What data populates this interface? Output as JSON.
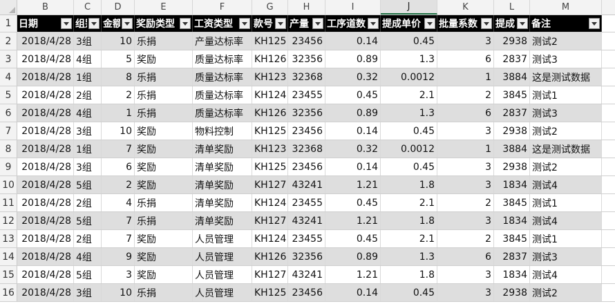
{
  "columns": [
    "B",
    "C",
    "D",
    "E",
    "F",
    "G",
    "H",
    "I",
    "J",
    "K",
    "L",
    "M"
  ],
  "selected_column": "J",
  "header_row_number": "1",
  "headers": [
    "日期",
    "组别",
    "金额",
    "奖励类型",
    "工资类型",
    "款号",
    "产量",
    "工序道数",
    "提成单价",
    "批量系数",
    "提成",
    "备注"
  ],
  "rows": [
    {
      "num": "2",
      "cells": [
        "2018/4/28",
        "3组",
        "10",
        "乐捐",
        "产量达标率",
        "KH125",
        "23456",
        "0.14",
        "0.45",
        "3",
        "2938",
        "测试2"
      ]
    },
    {
      "num": "3",
      "cells": [
        "2018/4/28",
        "4组",
        "5",
        "奖励",
        "质量达标率",
        "KH126",
        "32356",
        "0.89",
        "1.3",
        "6",
        "2837",
        "测试3"
      ]
    },
    {
      "num": "4",
      "cells": [
        "2018/4/28",
        "1组",
        "8",
        "乐捐",
        "质量达标率",
        "KH123",
        "32368",
        "0.32",
        "0.0012",
        "1",
        "3884",
        "这是测试数据"
      ]
    },
    {
      "num": "5",
      "cells": [
        "2018/4/28",
        "2组",
        "2",
        "乐捐",
        "质量达标率",
        "KH124",
        "23455",
        "0.45",
        "2.1",
        "2",
        "3845",
        "测试1"
      ]
    },
    {
      "num": "6",
      "cells": [
        "2018/4/28",
        "4组",
        "1",
        "乐捐",
        "质量达标率",
        "KH126",
        "32356",
        "0.89",
        "1.3",
        "6",
        "2837",
        "测试3"
      ]
    },
    {
      "num": "7",
      "cells": [
        "2018/4/28",
        "3组",
        "10",
        "奖励",
        "物料控制",
        "KH125",
        "23456",
        "0.14",
        "0.45",
        "3",
        "2938",
        "测试2"
      ]
    },
    {
      "num": "8",
      "cells": [
        "2018/4/28",
        "1组",
        "7",
        "奖励",
        "清单奖励",
        "KH123",
        "32368",
        "0.32",
        "0.0012",
        "1",
        "3884",
        "这是测试数据"
      ]
    },
    {
      "num": "9",
      "cells": [
        "2018/4/28",
        "3组",
        "6",
        "奖励",
        "清单奖励",
        "KH125",
        "23456",
        "0.14",
        "0.45",
        "3",
        "2938",
        "测试2"
      ]
    },
    {
      "num": "10",
      "cells": [
        "2018/4/28",
        "5组",
        "2",
        "奖励",
        "清单奖励",
        "KH127",
        "43241",
        "1.21",
        "1.8",
        "3",
        "1834",
        "测试4"
      ]
    },
    {
      "num": "11",
      "cells": [
        "2018/4/28",
        "2组",
        "4",
        "乐捐",
        "清单奖励",
        "KH124",
        "23455",
        "0.45",
        "2.1",
        "2",
        "3845",
        "测试1"
      ]
    },
    {
      "num": "12",
      "cells": [
        "2018/4/28",
        "5组",
        "7",
        "乐捐",
        "清单奖励",
        "KH127",
        "43241",
        "1.21",
        "1.8",
        "3",
        "1834",
        "测试4"
      ]
    },
    {
      "num": "13",
      "cells": [
        "2018/4/28",
        "2组",
        "7",
        "奖励",
        "人员管理",
        "KH124",
        "23455",
        "0.45",
        "2.1",
        "2",
        "3845",
        "测试1"
      ]
    },
    {
      "num": "14",
      "cells": [
        "2018/4/28",
        "4组",
        "9",
        "奖励",
        "人员管理",
        "KH126",
        "32356",
        "0.89",
        "1.3",
        "6",
        "2837",
        "测试3"
      ]
    },
    {
      "num": "15",
      "cells": [
        "2018/4/28",
        "5组",
        "3",
        "奖励",
        "人员管理",
        "KH127",
        "43241",
        "1.21",
        "1.8",
        "3",
        "1834",
        "测试4"
      ]
    },
    {
      "num": "16",
      "cells": [
        "2018/4/28",
        "3组",
        "10",
        "乐捐",
        "人员管理",
        "KH125",
        "23456",
        "0.14",
        "0.45",
        "3",
        "2938",
        "测试2"
      ]
    }
  ]
}
